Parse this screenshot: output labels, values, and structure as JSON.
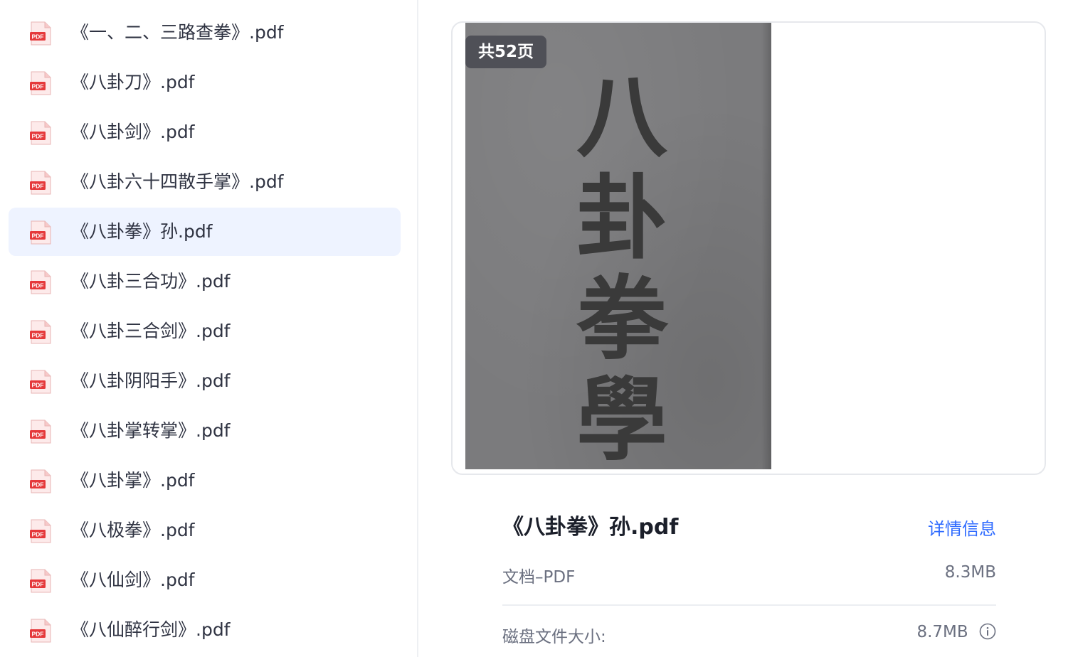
{
  "files": [
    {
      "name": "《一、二、三路查拳》.pdf",
      "icon": "pdf-icon"
    },
    {
      "name": "《八卦刀》.pdf",
      "icon": "pdf-icon"
    },
    {
      "name": "《八卦剑》.pdf",
      "icon": "pdf-icon"
    },
    {
      "name": "《八卦六十四散手掌》.pdf",
      "icon": "pdf-icon"
    },
    {
      "name": "《八卦拳》孙.pdf",
      "icon": "pdf-icon",
      "selected": true
    },
    {
      "name": "《八卦三合功》.pdf",
      "icon": "pdf-icon"
    },
    {
      "name": "《八卦三合剑》.pdf",
      "icon": "pdf-icon"
    },
    {
      "name": "《八卦阴阳手》.pdf",
      "icon": "pdf-icon"
    },
    {
      "name": "《八卦掌转掌》.pdf",
      "icon": "pdf-icon"
    },
    {
      "name": "《八卦掌》.pdf",
      "icon": "pdf-icon"
    },
    {
      "name": "《八极拳》.pdf",
      "icon": "pdf-icon"
    },
    {
      "name": "《八仙剑》.pdf",
      "icon": "pdf-icon"
    },
    {
      "name": "《八仙醉行剑》.pdf",
      "icon": "pdf-icon"
    }
  ],
  "preview": {
    "page_count_badge": "共52页",
    "cover_title": "八卦拳學"
  },
  "details": {
    "title": "《八卦拳》孙.pdf",
    "detail_link": "详情信息",
    "type_label": "文档–PDF",
    "size": "8.3MB",
    "disk_size_label": "磁盘文件大小:",
    "disk_size": "8.7MB"
  },
  "colors": {
    "selected_bg": "#eef3ff",
    "link": "#2f6bff",
    "pdf_red": "#e5393b"
  }
}
